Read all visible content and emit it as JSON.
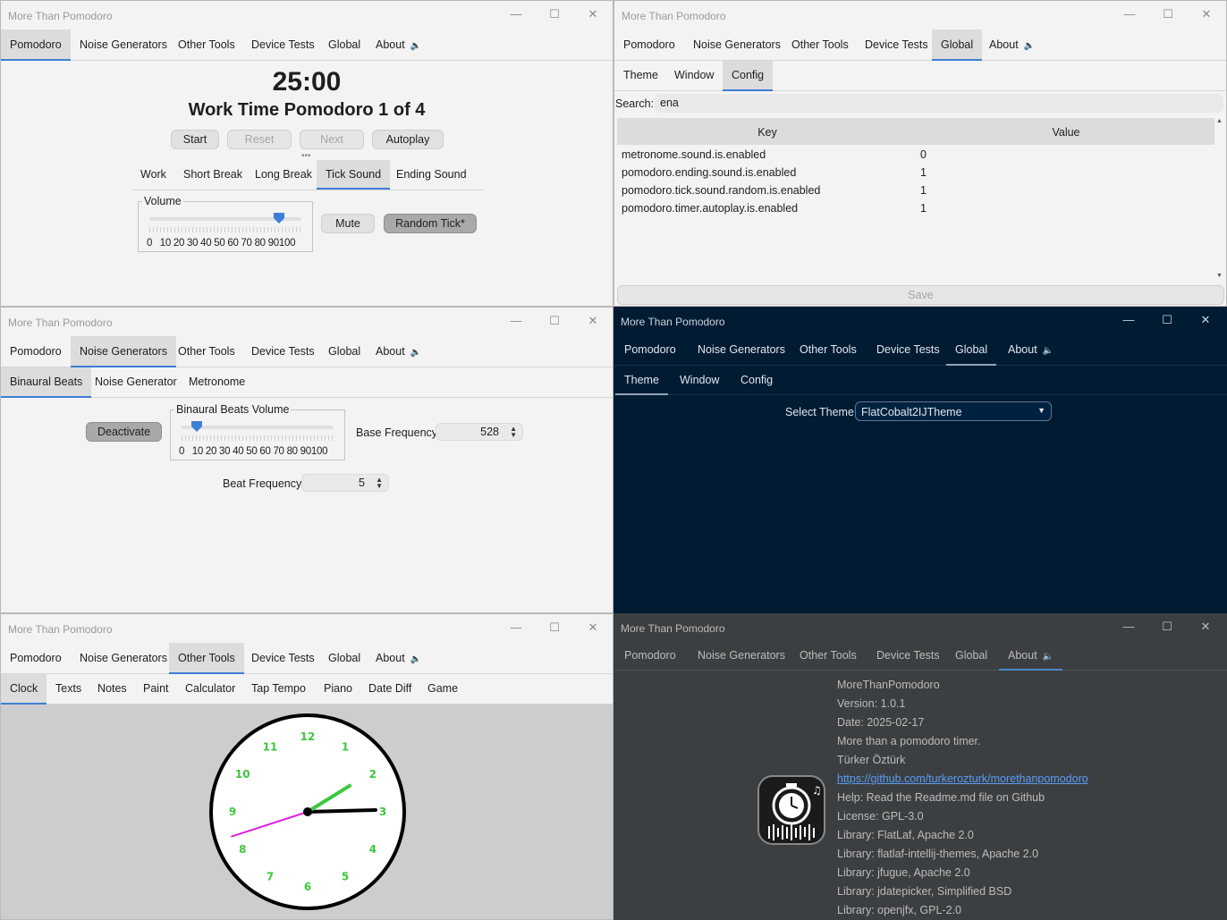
{
  "app": {
    "title": "More Than Pomodoro"
  },
  "main_tabs": [
    "Pomodoro",
    "Noise Generators",
    "Other Tools",
    "Device Tests",
    "Global",
    "About"
  ],
  "window_controls": {
    "minimize_icon": "minimize-icon",
    "maximize_icon": "maximize-icon",
    "close_icon": "close-icon"
  },
  "pomodoro": {
    "time": "25:00",
    "status": "Work Time Pomodoro 1 of 4",
    "buttons": {
      "start": "Start",
      "reset": "Reset",
      "next": "Next",
      "autoplay": "Autoplay"
    },
    "sub_tabs": [
      "Work",
      "Short Break",
      "Long Break",
      "Tick Sound",
      "Ending Sound"
    ],
    "selected_sub_tab": "Tick Sound",
    "volume": {
      "label": "Volume",
      "level_percent": 85,
      "scale": [
        "0",
        "10",
        "20",
        "30",
        "40",
        "50",
        "60",
        "70",
        "80",
        "90",
        "100"
      ]
    },
    "mute_label": "Mute",
    "random_tick_label": "Random Tick*"
  },
  "config": {
    "sub_tabs": [
      "Theme",
      "Window",
      "Config"
    ],
    "search_label": "Search:",
    "search_value": "ena",
    "columns": [
      "Key",
      "Value"
    ],
    "rows": [
      {
        "key": "metronome.sound.is.enabled",
        "value": "0"
      },
      {
        "key": "pomodoro.ending.sound.is.enabled",
        "value": "1"
      },
      {
        "key": "pomodoro.tick.sound.random.is.enabled",
        "value": "1"
      },
      {
        "key": "pomodoro.timer.autoplay.is.enabled",
        "value": "1"
      }
    ],
    "save_label": "Save"
  },
  "noise": {
    "sub_tabs": [
      "Binaural Beats",
      "Noise Generator",
      "Metronome"
    ],
    "deactivate_label": "Deactivate",
    "volume_label": "Binaural Beats Volume",
    "volume_level_percent": 10,
    "scale": [
      "0",
      "10",
      "20",
      "30",
      "40",
      "50",
      "60",
      "70",
      "80",
      "90",
      "100"
    ],
    "base_frequency_label": "Base Frequency",
    "base_frequency_value": "528",
    "beat_frequency_label": "Beat Frequency",
    "beat_frequency_value": "5"
  },
  "theme": {
    "sub_tabs": [
      "Theme",
      "Window",
      "Config"
    ],
    "select_label": "Select Theme",
    "selected_theme": "FlatCobalt2IJTheme",
    "colors": {
      "background": "#011b33",
      "accent": "#3c7fd6"
    }
  },
  "tools": {
    "sub_tabs": [
      "Clock",
      "Texts",
      "Notes",
      "Paint",
      "Calculator",
      "Tap Tempo",
      "Piano",
      "Date Diff",
      "Game"
    ],
    "clock": {
      "numbers": [
        "12",
        "1",
        "2",
        "3",
        "4",
        "5",
        "6",
        "7",
        "8",
        "9",
        "10",
        "11"
      ],
      "number_color": "#3cc83c",
      "hour_hand_color": "#000000",
      "minute_hand_color": "#3cc83c",
      "second_hand_color": "#e020e0",
      "time_shown": "2:59:42"
    }
  },
  "about": {
    "lines": [
      "MoreThanPomodoro",
      "Version: 1.0.1",
      "Date: 2025-02-17",
      "More than a pomodoro timer.",
      "Türker Öztürk",
      "https://github.com/turkerozturk/morethanpomodoro",
      "Help: Read the Readme.md file on Github",
      "License: GPL-3.0",
      "Library: FlatLaf, Apache 2.0",
      "Library: flatlaf-intellij-themes, Apache 2.0",
      "Library: jfugue, Apache 2.0",
      "Library: jdatepicker, Simplified BSD",
      "Library: openjfx, GPL-2.0"
    ],
    "link_color": "#589df6",
    "logo_icon": "pomodoro-clock-logo-icon"
  }
}
